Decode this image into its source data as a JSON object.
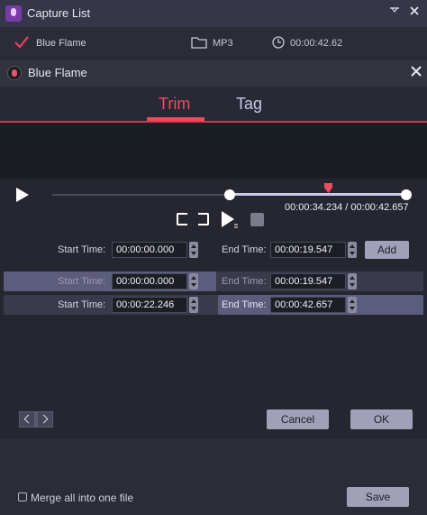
{
  "window": {
    "title": "Capture List",
    "icon": "microphone-icon",
    "controls": [
      "pin-icon",
      "close-icon"
    ]
  },
  "capture_item": {
    "name": "Blue Flame",
    "format": "MP3",
    "duration": "00:00:42.62",
    "checked": true
  },
  "dialog": {
    "title": "Blue Flame",
    "tabs": [
      {
        "label": "Trim",
        "active": true
      },
      {
        "label": "Tag",
        "active": false
      }
    ],
    "player": {
      "current_time": "00:00:34.234",
      "total_time": "00:00:42.657",
      "time_readout": "00:00:34.234 / 00:00:42.657",
      "selection_start_fraction": 0.5,
      "selection_end_fraction": 1.0,
      "playhead_fraction": 0.8
    },
    "editor": {
      "start_label": "Start Time:",
      "start_value": "00:00:00.000",
      "end_label": "End Time:",
      "end_value": "00:00:19.547",
      "add_label": "Add"
    },
    "segments": [
      {
        "start_label": "Start Time:",
        "start": "00:00:00.000",
        "end_label": "End Time:",
        "end": "00:00:19.547"
      },
      {
        "start_label": "Start Time:",
        "start": "00:00:22.246",
        "end_label": "End Time:",
        "end": "00:00:42.657"
      }
    ],
    "cancel_label": "Cancel",
    "ok_label": "OK"
  },
  "footer": {
    "merge_label": "Merge all into one file",
    "merge_checked": false,
    "save_label": "Save"
  },
  "colors": {
    "accent": "#ef4b5e",
    "selection": "#c9c9f0",
    "background": "#262631"
  }
}
